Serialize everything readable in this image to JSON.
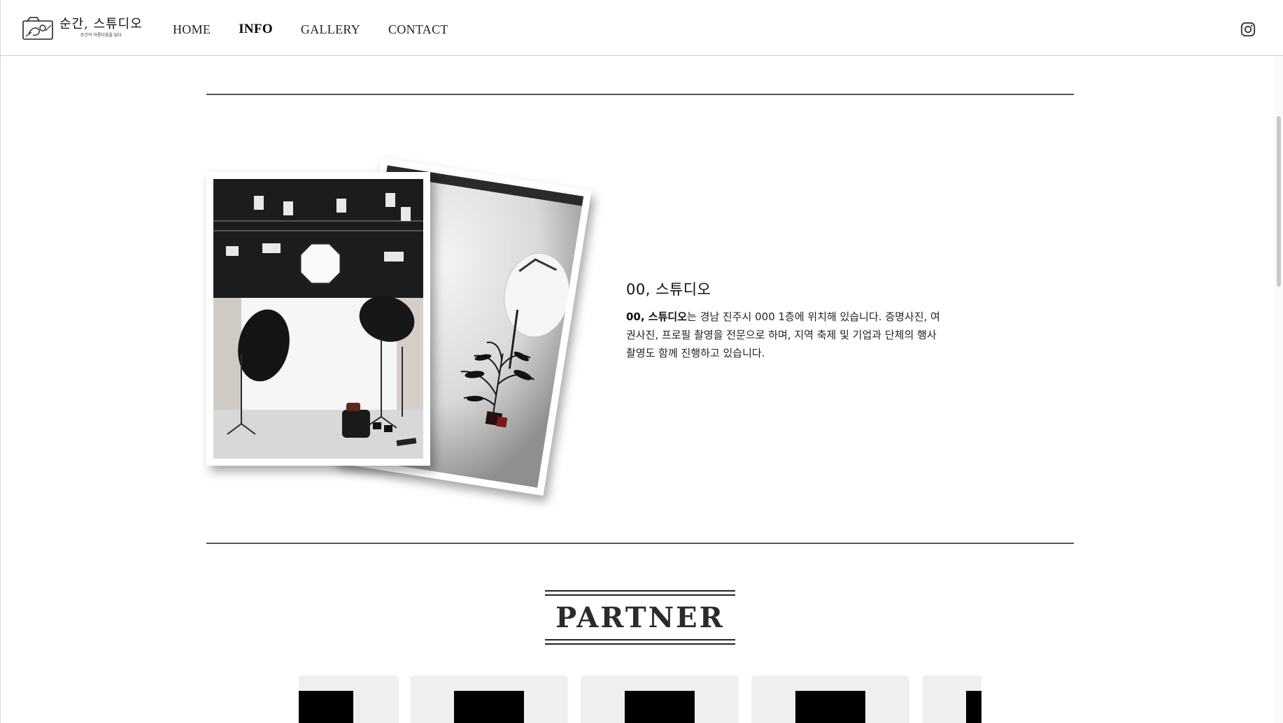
{
  "header": {
    "logo": {
      "title": "순간, 스튜디오",
      "subtitle": "순간의 아름다움을 담다"
    },
    "nav": [
      {
        "label": "HOME",
        "active": false
      },
      {
        "label": "INFO",
        "active": true
      },
      {
        "label": "GALLERY",
        "active": false
      },
      {
        "label": "CONTACT",
        "active": false
      }
    ],
    "social_icon": "instagram-icon"
  },
  "info": {
    "title": "00, 스튜디오",
    "description_bold": "00, 스튜디오",
    "description_rest": "는 경남 진주시 000 1층에 위치해 있습니다. 증명사진, 여권사진, 프로필 촬영을 전문으로 하며, 지역 축제 및 기업과 단체의 행사 촬영도 함께 진행하고 있습니다."
  },
  "partner": {
    "heading": "PARTNER",
    "cards": 5
  },
  "colors": {
    "divider": "#555555",
    "card_bg": "#efefef",
    "partner_text": "#2b2b2b"
  }
}
